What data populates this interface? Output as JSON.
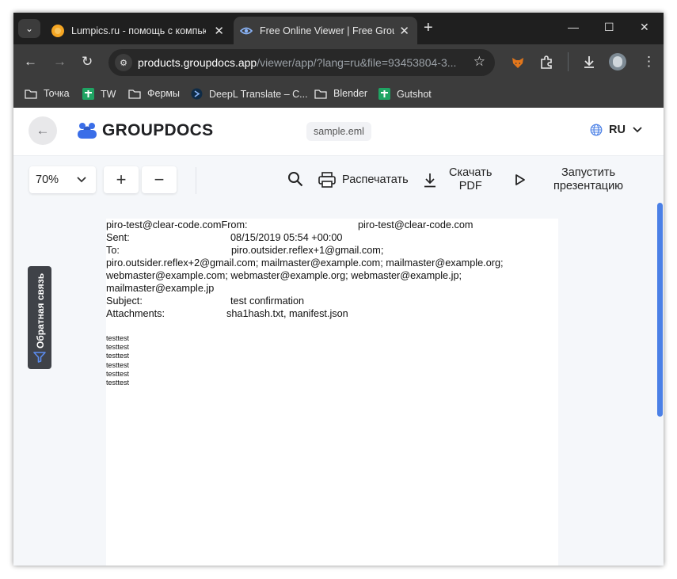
{
  "browser": {
    "tabs": [
      {
        "title": "Lumpics.ru - помощь с компьютером",
        "active": false,
        "icon": "lumpics-favicon"
      },
      {
        "title": "Free Online Viewer | Free GroupDocs Apps",
        "active": true,
        "icon": "eye-favicon"
      }
    ],
    "url": {
      "host": "products.groupdocs.app",
      "path": "/viewer/app/?lang=ru&file=93453804-3..."
    },
    "bookmarks": [
      {
        "label": "Точка",
        "icon": "folder-icon"
      },
      {
        "label": "TW",
        "icon": "sheets-icon"
      },
      {
        "label": "Фермы",
        "icon": "folder-icon"
      },
      {
        "label": "DeepL Translate – С...",
        "icon": "deepl-icon"
      },
      {
        "label": "Blender",
        "icon": "folder-icon"
      },
      {
        "label": "Gutshot",
        "icon": "sheets-icon"
      }
    ]
  },
  "app": {
    "logo": "GROUPDOCS",
    "file_name": "sample.eml",
    "language": "RU",
    "zoom": "70%",
    "print_label": "Распечатать",
    "download_label_1": "Скачать",
    "download_label_2": "PDF",
    "present_label_1": "Запустить",
    "present_label_2": "презентацию",
    "feedback_label": "Обратная связь"
  },
  "document": {
    "lines": [
      "piro-test@clear-code.comFrom:",
      "Sent:",
      "To:",
      "piro.outsider.reflex+2@gmail.com; mailmaster@example.com; mailmaster@example.org;",
      "webmaster@example.com; webmaster@example.org; webmaster@example.jp;",
      "mailmaster@example.jp",
      "Subject:",
      "Attachments:"
    ],
    "from_value": "piro-test@clear-code.com",
    "sent_value": "08/15/2019 05:54 +00:00",
    "to_value": "piro.outsider.reflex+1@gmail.com;",
    "subject_value": "test confirmation",
    "attachments_value": "sha1hash.txt, manifest.json",
    "body": [
      "testtest",
      "testtest",
      "testtest",
      "testtest",
      "testtest",
      "testtest"
    ]
  },
  "colors": {
    "accent": "#4b80e6",
    "chrome_dark": "#1f1f1f",
    "chrome_toolbar": "#3c3c3c"
  }
}
